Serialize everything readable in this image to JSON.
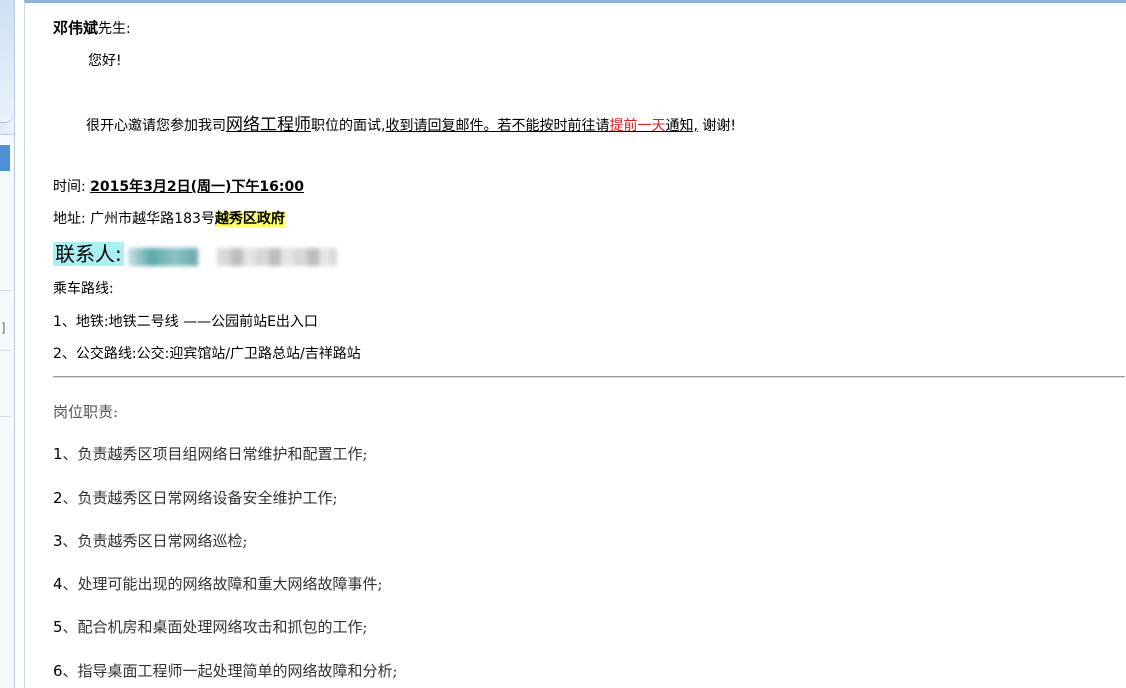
{
  "greeting": {
    "name": "邓伟斌",
    "suffix": "先生:",
    "hello": "您好!"
  },
  "invitation": {
    "intro": "很开心邀请您参加我司",
    "position": "网络工程师",
    "after_position": "职位的面试,",
    "reply_note_a": "收到请回复邮件。若不能按时前往请",
    "advance": "提前一天",
    "reply_note_b": "通知,",
    "thanks": " 谢谢!"
  },
  "details": {
    "time_label": "时间:",
    "time_value": "2015年3月2日(周一)下午16:00",
    "address_label": "地址:",
    "address_value": "广州市越华路183号",
    "address_highlight": "越秀区政府",
    "contact_label": "联系人:",
    "route_label": "乘车路线:",
    "route_subway": "1、地铁:地铁二号线 ——公园前站E出入口",
    "route_bus": "2、公交路线:公交:迎宾馆站/广卫路总站/吉祥路站"
  },
  "duties": {
    "title": "岗位职责:",
    "items": [
      {
        "num": "1",
        "text": "、负责越秀区项目组网络日常维护和配置工作;"
      },
      {
        "num": "2",
        "text": "、负责越秀区日常网络设备安全维护工作;"
      },
      {
        "num": "3",
        "text": "、负责越秀区日常网络巡检;"
      },
      {
        "num": "4",
        "text": "、处理可能出现的网络故障和重大网络故障事件;"
      },
      {
        "num": "5",
        "text": "、配合机房和桌面处理网络攻击和抓包的工作;"
      },
      {
        "num": "6",
        "text": "、指导桌面工程师一起处理简单的网络故障和分析;"
      }
    ]
  },
  "sidebar": {
    "bracket": "]"
  }
}
